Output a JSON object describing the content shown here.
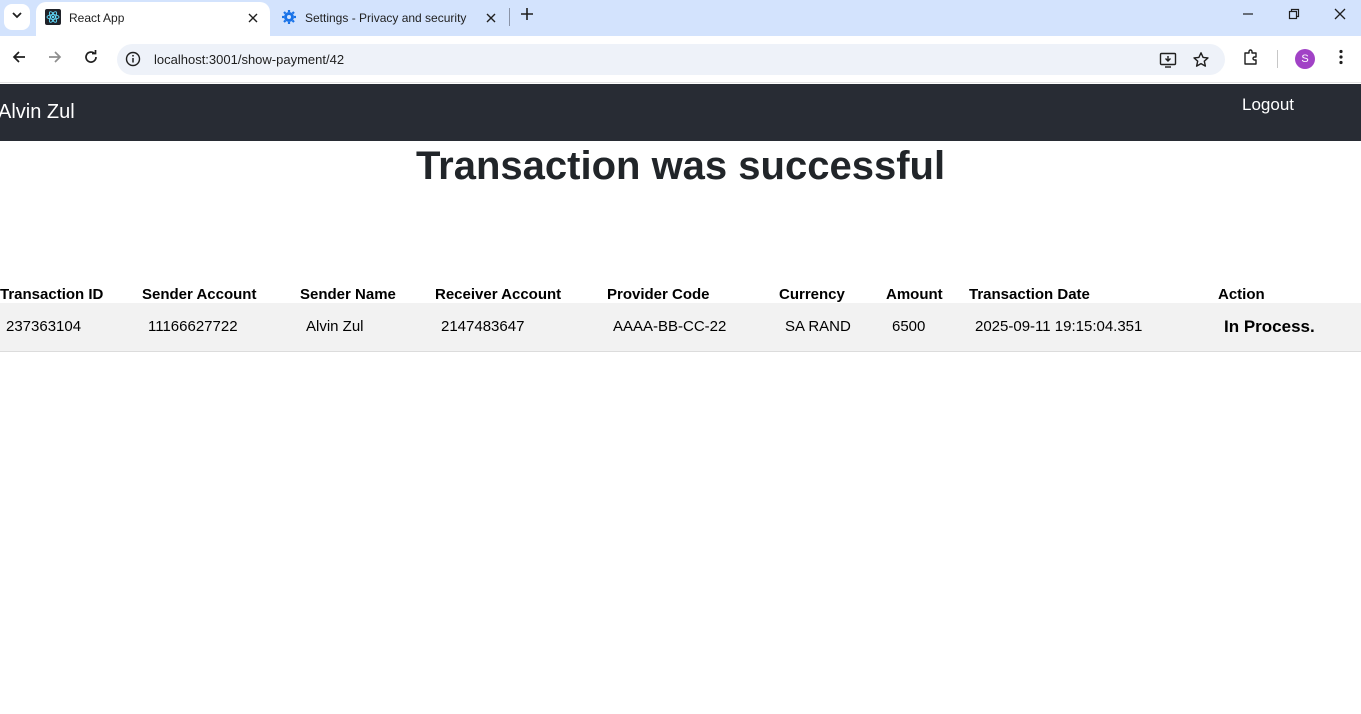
{
  "browser": {
    "tabs": [
      {
        "title": "React App",
        "icon": "react-icon",
        "active": true
      },
      {
        "title": "Settings - Privacy and security",
        "icon": "gear-icon",
        "active": false
      }
    ],
    "url": "localhost:3001/show-payment/42",
    "profile_initial": "S"
  },
  "navbar": {
    "brand": "Alvin Zul",
    "logout_label": "Logout"
  },
  "page": {
    "heading": "Transaction was successful"
  },
  "table": {
    "columns": [
      "Transaction ID",
      "Sender Account",
      "Sender Name",
      "Receiver Account",
      "Provider Code",
      "Currency",
      "Amount",
      "Transaction Date",
      "Action"
    ],
    "rows": [
      [
        "237363104",
        "11166627722",
        "Alvin Zul",
        "2147483647",
        "AAAA-BB-CC-22",
        "SA RAND",
        "6500",
        "2025-09-11 19:15:04.351",
        "In Process."
      ]
    ]
  },
  "colors": {
    "navbar_bg": "#282c34",
    "tabstrip_bg": "#d3e3fd",
    "row_bg": "#f2f2f2",
    "avatar_bg": "#a142c6"
  }
}
